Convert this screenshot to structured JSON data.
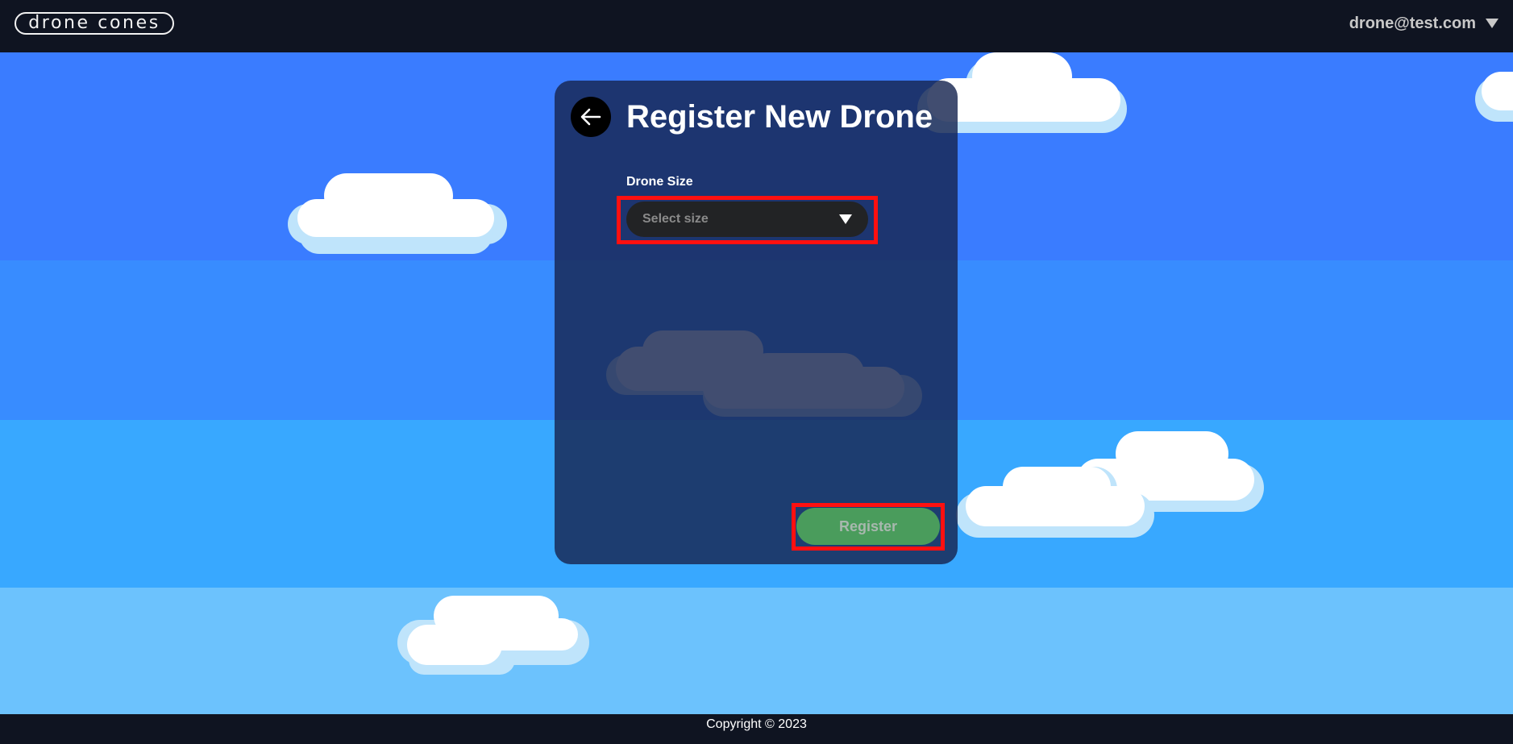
{
  "header": {
    "logo_text": "drone cones",
    "user_email": "drone@test.com",
    "user_menu_icon": "chevron-down-icon"
  },
  "form": {
    "back_icon": "arrow-left-icon",
    "title": "Register New Drone",
    "size_label": "Drone Size",
    "size_select": {
      "selected": "Select size",
      "icon": "caret-down-icon"
    },
    "register_label": "Register"
  },
  "footer": {
    "copyright": "Copyright © 2023"
  },
  "colors": {
    "header_bg": "#0f1421",
    "sky_band_1": "#3a7cff",
    "sky_band_2": "#388cff",
    "sky_band_3": "#38a8ff",
    "sky_band_4": "#6cc2fd",
    "card_bg": "#172650",
    "register_button": "#4a9c5c",
    "highlight": "#ff1010"
  }
}
